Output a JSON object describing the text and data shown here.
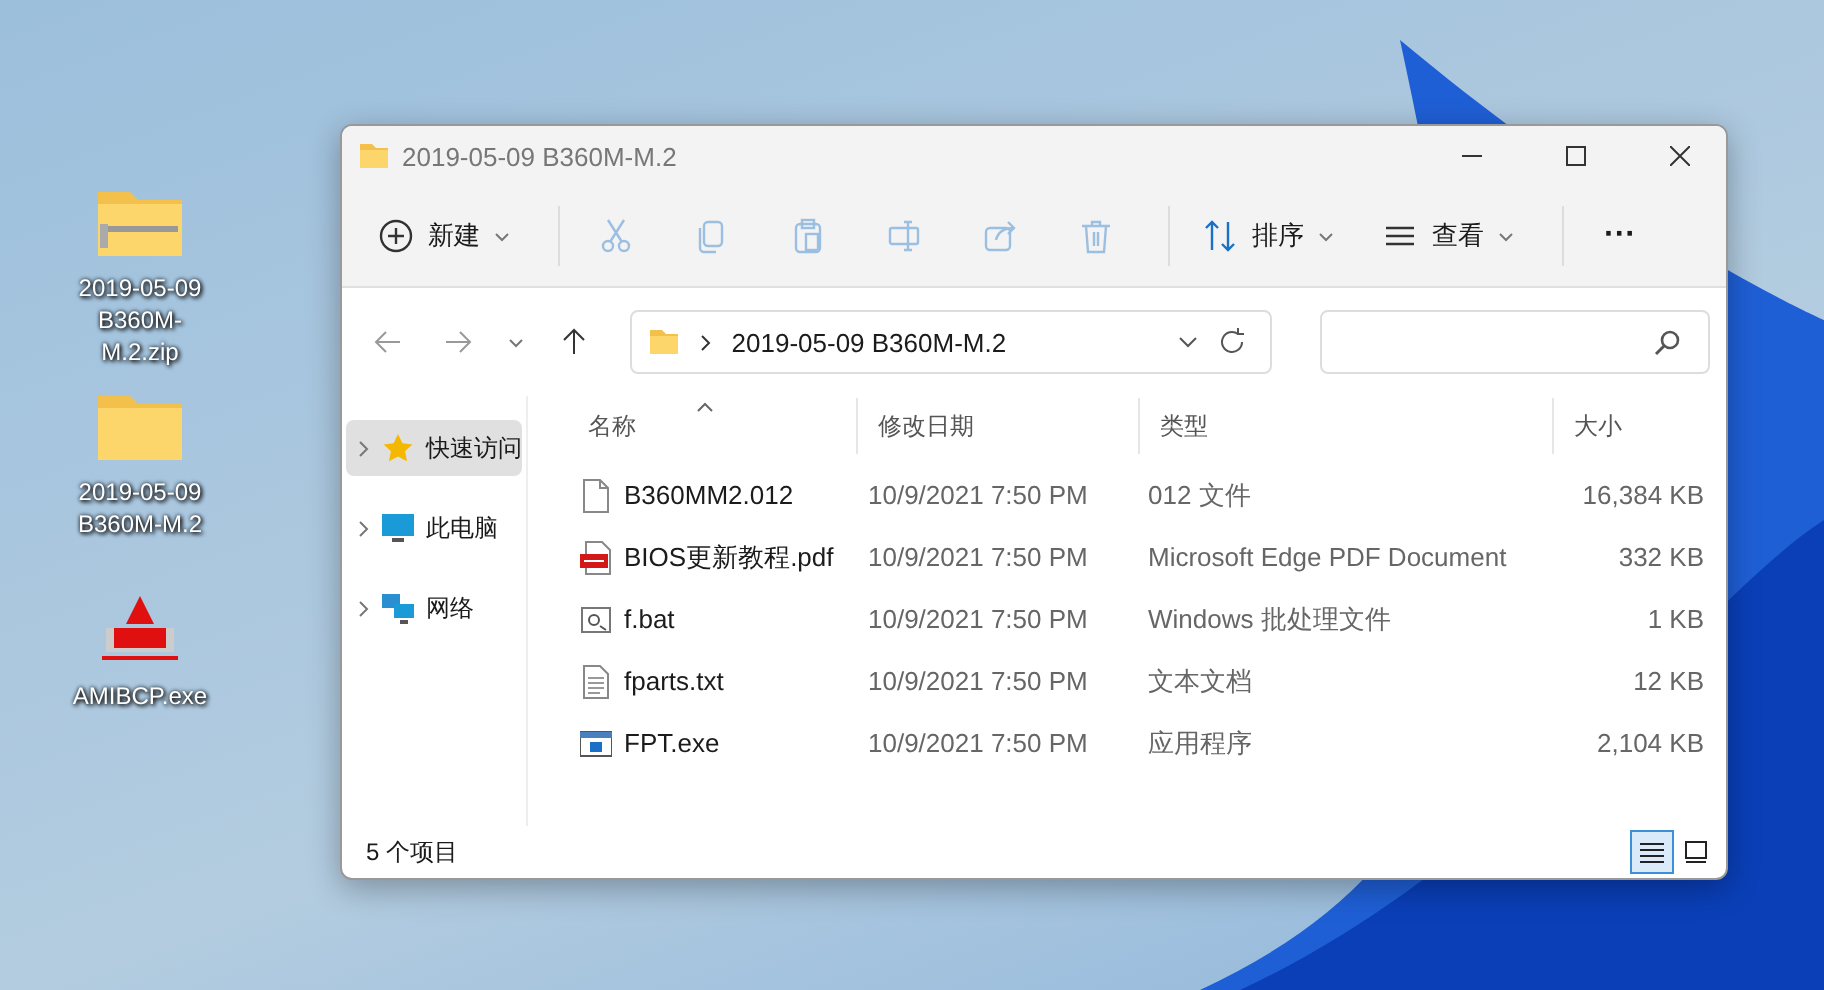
{
  "desktop": {
    "icons": [
      {
        "kind": "zip",
        "label": "2019-05-09 B360M-M.2.zip"
      },
      {
        "kind": "folder",
        "label": "2019-05-09 B360M-M.2"
      },
      {
        "kind": "exe",
        "label": "AMIBCP.exe"
      }
    ]
  },
  "window": {
    "title": "2019-05-09 B360M-M.2"
  },
  "toolbar": {
    "items": [
      {
        "kind": "new",
        "label": "新建",
        "disabled": false
      },
      {
        "kind": "cut",
        "disabled": true
      },
      {
        "kind": "copy",
        "disabled": true
      },
      {
        "kind": "paste",
        "disabled": true
      },
      {
        "kind": "rename",
        "disabled": true
      },
      {
        "kind": "share",
        "disabled": true
      },
      {
        "kind": "delete",
        "disabled": true
      },
      {
        "kind": "sort",
        "label": "排序",
        "disabled": false
      },
      {
        "kind": "view",
        "label": "查看",
        "disabled": false
      },
      {
        "kind": "more",
        "label": "···",
        "disabled": false
      }
    ]
  },
  "address": {
    "path": "2019-05-09 B360M-M.2"
  },
  "sidebar": {
    "items": [
      {
        "kind": "star",
        "label": "快速访问",
        "selected": true
      },
      {
        "kind": "pc",
        "label": "此电脑",
        "selected": false
      },
      {
        "kind": "network",
        "label": "网络",
        "selected": false
      }
    ]
  },
  "table": {
    "columns": [
      {
        "label": "名称",
        "sorted": true
      },
      {
        "label": "修改日期",
        "sorted": false
      },
      {
        "label": "类型",
        "sorted": false
      },
      {
        "label": "大小",
        "sorted": false
      }
    ],
    "rows": [
      {
        "kind": "file",
        "name": "B360MM2.012",
        "date": "10/9/2021 7:50 PM",
        "type": "012 文件",
        "size": "16,384 KB"
      },
      {
        "kind": "pdf",
        "name": "BIOS更新教程.pdf",
        "date": "10/9/2021 7:50 PM",
        "type": "Microsoft Edge PDF Document",
        "size": "332 KB"
      },
      {
        "kind": "bat",
        "name": "f.bat",
        "date": "10/9/2021 7:50 PM",
        "type": "Windows 批处理文件",
        "size": "1 KB"
      },
      {
        "kind": "txt",
        "name": "fparts.txt",
        "date": "10/9/2021 7:50 PM",
        "type": "文本文档",
        "size": "12 KB"
      },
      {
        "kind": "exe",
        "name": "FPT.exe",
        "date": "10/9/2021 7:50 PM",
        "type": "应用程序",
        "size": "2,104 KB"
      }
    ]
  },
  "status_bar": {
    "count": "5 个项目",
    "views": [
      {
        "kind": "details",
        "selected": true
      },
      {
        "kind": "tiles",
        "selected": false
      }
    ]
  }
}
